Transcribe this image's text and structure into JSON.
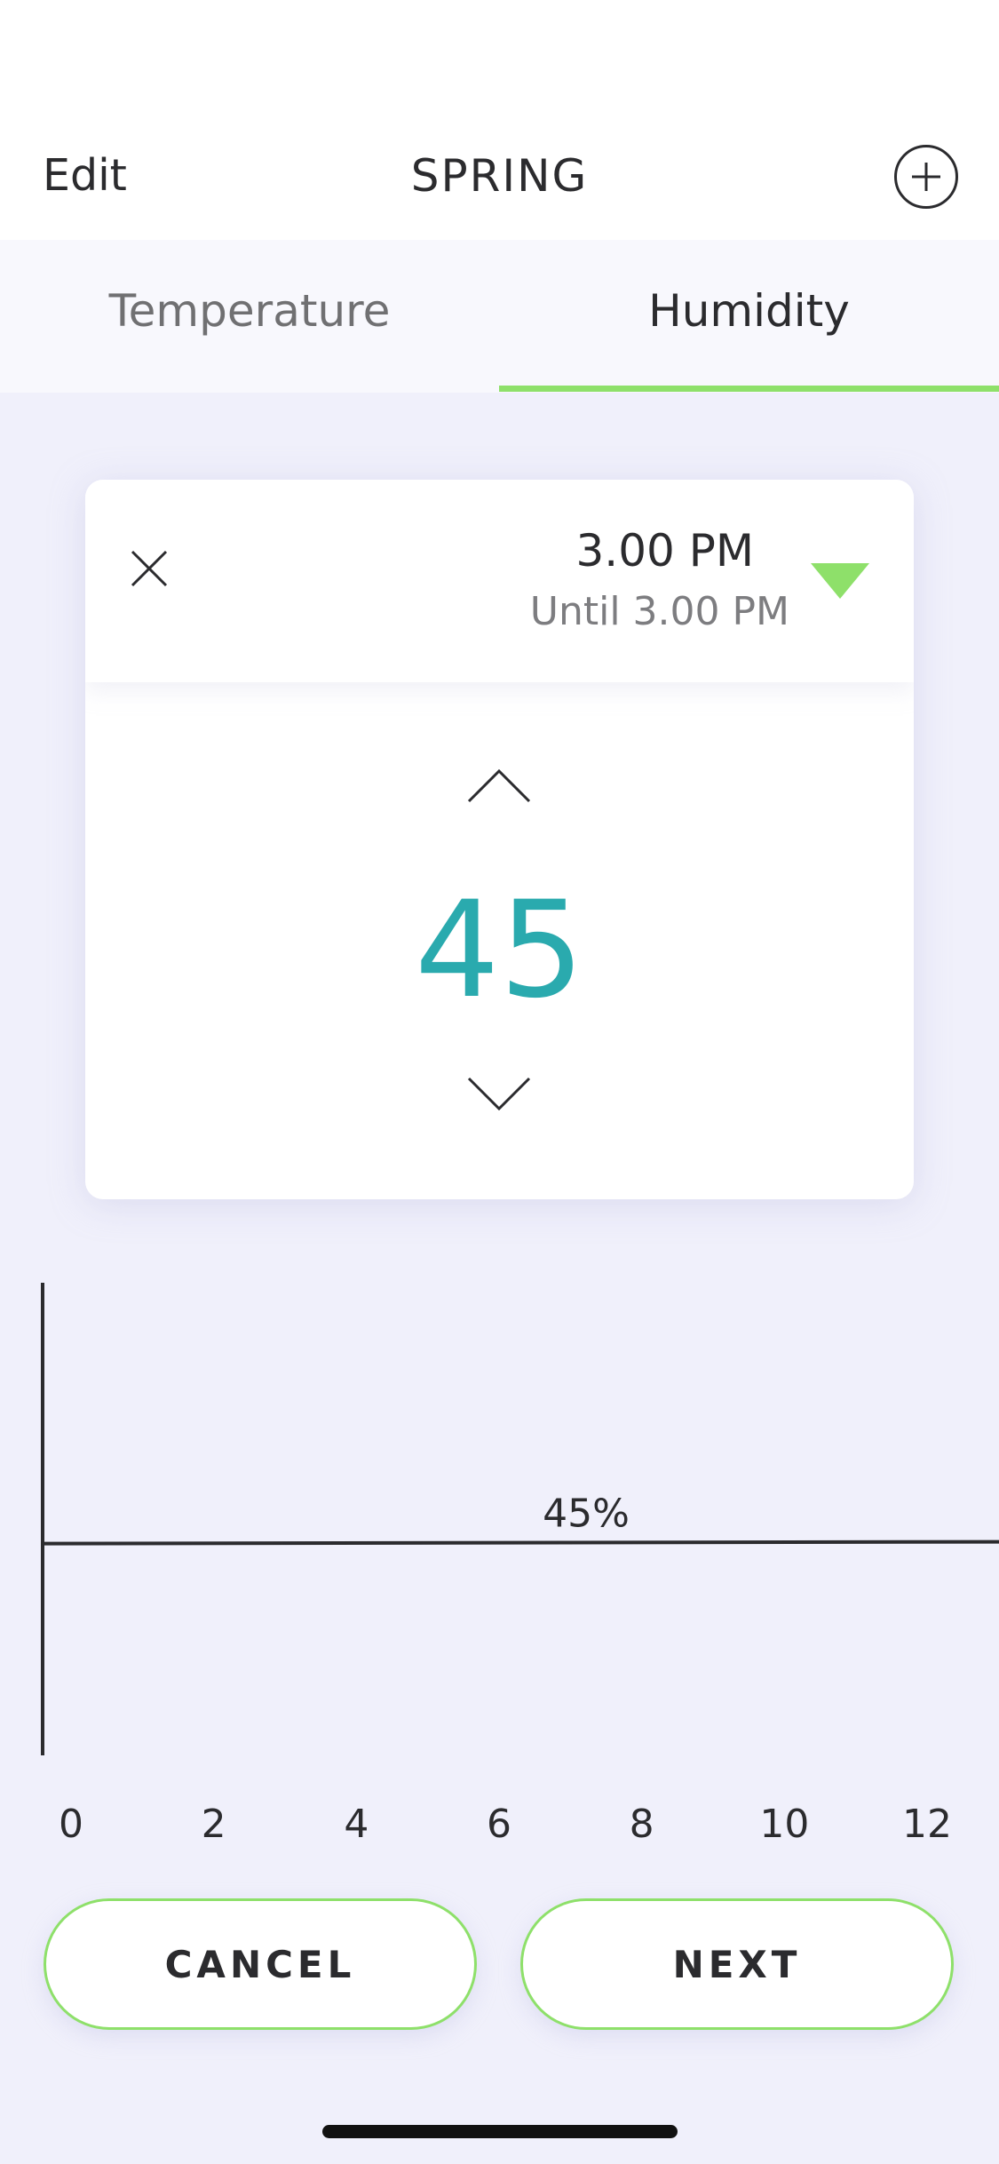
{
  "navbar": {
    "edit_label": "Edit",
    "title": "SPRING",
    "add_icon": "plus-circle-icon"
  },
  "tabs": [
    {
      "label": "Temperature",
      "active": false
    },
    {
      "label": "Humidity",
      "active": true
    }
  ],
  "card": {
    "time": "3.00 PM",
    "until": "Until 3.00 PM",
    "value": "45",
    "close_icon": "close-icon",
    "dropdown_icon": "triangle-down-icon",
    "up_icon": "chevron-up-icon",
    "down_icon": "chevron-down-icon"
  },
  "chart_data": {
    "type": "line",
    "x": [
      0,
      12
    ],
    "series": [
      {
        "values": [
          45,
          45
        ]
      }
    ],
    "x_ticks": [
      "0",
      "2",
      "4",
      "6",
      "8",
      "10",
      "12"
    ],
    "annotation": "45%",
    "xlim": [
      0,
      12
    ],
    "ylim": [
      0,
      100
    ],
    "grid": false
  },
  "buttons": {
    "cancel_label": "CANCEL",
    "next_label": "NEXT"
  },
  "colors": {
    "accent_green": "#8ee06a",
    "value_teal": "#2aaaae",
    "background": "#f0f0fb"
  }
}
